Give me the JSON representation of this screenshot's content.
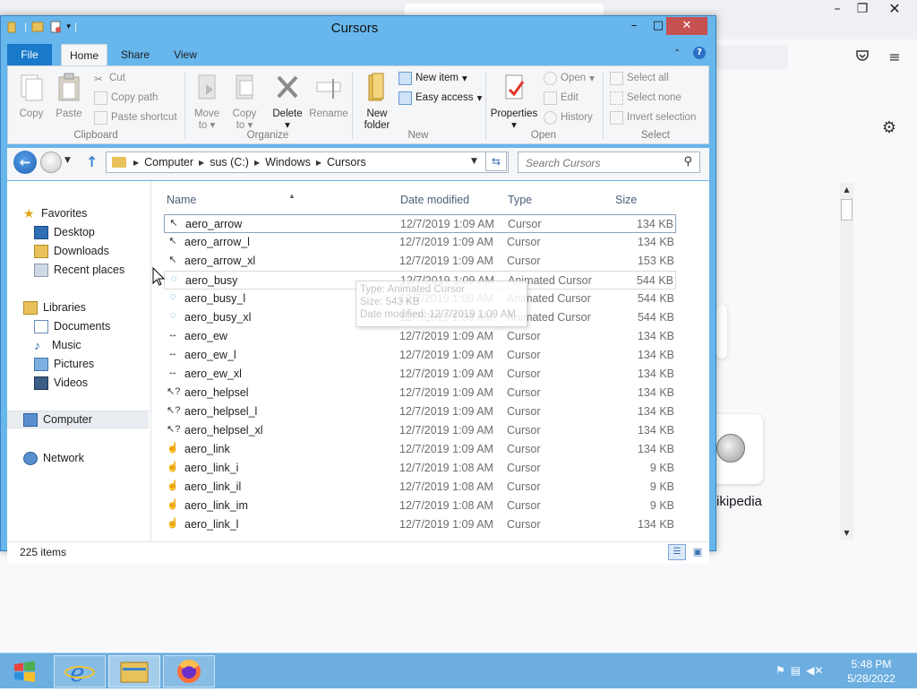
{
  "window": {
    "title": "Cursors",
    "controls": {
      "minimize": "–",
      "maximize": "□",
      "close": "✕"
    }
  },
  "ribbon": {
    "tabs": [
      {
        "label": "File"
      },
      {
        "label": "Home"
      },
      {
        "label": "Share"
      },
      {
        "label": "View"
      }
    ],
    "groups": {
      "clipboard": {
        "label": "Clipboard",
        "copy": "Copy",
        "paste": "Paste",
        "cut": "Cut",
        "copy_path": "Copy path",
        "paste_shortcut": "Paste shortcut"
      },
      "organize": {
        "label": "Organize",
        "move_to": "Move",
        "move_to_2": "to",
        "copy_to": "Copy",
        "copy_to_2": "to",
        "delete": "Delete",
        "rename": "Rename"
      },
      "new": {
        "label": "New",
        "new_folder": "New",
        "new_folder_2": "folder",
        "new_item": "New item",
        "easy_access": "Easy access"
      },
      "open": {
        "label": "Open",
        "properties": "Properties",
        "open": "Open",
        "edit": "Edit",
        "history": "History"
      },
      "select": {
        "label": "Select",
        "select_all": "Select all",
        "select_none": "Select none",
        "invert_selection": "Invert selection"
      }
    }
  },
  "address": {
    "crumbs": [
      "Computer",
      "sus (C:)",
      "Windows",
      "Cursors"
    ],
    "search_placeholder": "Search Cursors"
  },
  "navpane": {
    "favorites": "Favorites",
    "desktop": "Desktop",
    "downloads": "Downloads",
    "recent_places": "Recent places",
    "libraries": "Libraries",
    "documents": "Documents",
    "music": "Music",
    "pictures": "Pictures",
    "videos": "Videos",
    "computer": "Computer",
    "network": "Network"
  },
  "filelist": {
    "columns": {
      "name": "Name",
      "date": "Date modified",
      "type": "Type",
      "size": "Size"
    },
    "rows": [
      {
        "name": "aero_arrow",
        "date": "12/7/2019 1:09 AM",
        "type": "Cursor",
        "size": "134 KB",
        "icon": "arrow-cursor-icon"
      },
      {
        "name": "aero_arrow_l",
        "date": "12/7/2019 1:09 AM",
        "type": "Cursor",
        "size": "134 KB",
        "icon": "arrow-cursor-icon"
      },
      {
        "name": "aero_arrow_xl",
        "date": "12/7/2019 1:09 AM",
        "type": "Cursor",
        "size": "153 KB",
        "icon": "arrow-cursor-icon"
      },
      {
        "name": "aero_busy",
        "date": "12/7/2019 1:09 AM",
        "type": "Animated Cursor",
        "size": "544 KB",
        "icon": "busy-cursor-icon"
      },
      {
        "name": "aero_busy_l",
        "date": "12/7/2019 1:09 AM",
        "type": "Animated Cursor",
        "size": "544 KB",
        "icon": "busy-cursor-icon"
      },
      {
        "name": "aero_busy_xl",
        "date": "12/7/2019 1:09 AM",
        "type": "Animated Cursor",
        "size": "544 KB",
        "icon": "busy-cursor-icon"
      },
      {
        "name": "aero_ew",
        "date": "12/7/2019 1:09 AM",
        "type": "Cursor",
        "size": "134 KB",
        "icon": "resize-ew-cursor-icon"
      },
      {
        "name": "aero_ew_l",
        "date": "12/7/2019 1:09 AM",
        "type": "Cursor",
        "size": "134 KB",
        "icon": "resize-ew-cursor-icon"
      },
      {
        "name": "aero_ew_xl",
        "date": "12/7/2019 1:09 AM",
        "type": "Cursor",
        "size": "134 KB",
        "icon": "resize-ew-cursor-icon"
      },
      {
        "name": "aero_helpsel",
        "date": "12/7/2019 1:09 AM",
        "type": "Cursor",
        "size": "134 KB",
        "icon": "help-cursor-icon"
      },
      {
        "name": "aero_helpsel_l",
        "date": "12/7/2019 1:09 AM",
        "type": "Cursor",
        "size": "134 KB",
        "icon": "help-cursor-icon"
      },
      {
        "name": "aero_helpsel_xl",
        "date": "12/7/2019 1:09 AM",
        "type": "Cursor",
        "size": "134 KB",
        "icon": "help-cursor-icon"
      },
      {
        "name": "aero_link",
        "date": "12/7/2019 1:09 AM",
        "type": "Cursor",
        "size": "134 KB",
        "icon": "hand-cursor-icon"
      },
      {
        "name": "aero_link_i",
        "date": "12/7/2019 1:08 AM",
        "type": "Cursor",
        "size": "9 KB",
        "icon": "hand-cursor-icon"
      },
      {
        "name": "aero_link_il",
        "date": "12/7/2019 1:08 AM",
        "type": "Cursor",
        "size": "9 KB",
        "icon": "hand-cursor-icon"
      },
      {
        "name": "aero_link_im",
        "date": "12/7/2019 1:08 AM",
        "type": "Cursor",
        "size": "9 KB",
        "icon": "hand-cursor-icon"
      },
      {
        "name": "aero_link_l",
        "date": "12/7/2019 1:09 AM",
        "type": "Cursor",
        "size": "134 KB",
        "icon": "hand-cursor-icon"
      }
    ]
  },
  "tooltip": {
    "type": "Type: Animated Cursor",
    "size": "Size: 543 KB",
    "date": "Date modified: 12/7/2019 1:09 AM"
  },
  "status": {
    "count": "225 items"
  },
  "browser": {
    "wiki_label": "ikipedia"
  },
  "taskbar": {
    "time": "5:48 PM",
    "date": "5/28/2022"
  },
  "colors": {
    "accent": "#1979ca",
    "frame": "#67b6ec",
    "taskbar": "#6daee0",
    "close": "#c75050"
  }
}
